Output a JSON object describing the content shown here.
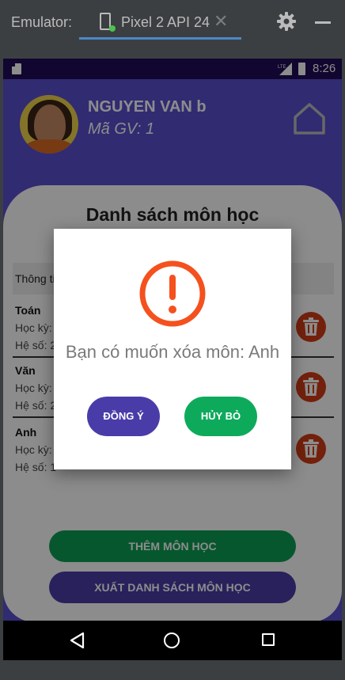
{
  "emulator": {
    "label": "Emulator:",
    "tab_label": "Pixel 2 API 24",
    "close_glyph": "✕",
    "icons": [
      "phone-device-icon",
      "close-icon",
      "gear-icon",
      "minimize-icon"
    ]
  },
  "status_bar": {
    "time": "8:26",
    "icons": [
      "sd-card-icon",
      "lte-signal-icon",
      "battery-icon"
    ]
  },
  "profile": {
    "name": "NGUYEN VAN b",
    "id_text": "Mã GV: 1",
    "icons": [
      "avatar",
      "home-icon"
    ]
  },
  "list": {
    "title": "Danh sách môn học",
    "header": "Thông ti",
    "subjects": [
      {
        "name": "Toán",
        "semester": "Học kỳ:",
        "coefficient": "Hệ số: 2"
      },
      {
        "name": "Văn",
        "semester": "Học kỳ:",
        "coefficient": "Hệ số: 2"
      },
      {
        "name": "Anh",
        "semester": "Học kỳ:",
        "coefficient": "Hệ số: 1"
      }
    ],
    "delete_icon": "trash-icon"
  },
  "actions": {
    "add_label": "THÊM MÔN HỌC",
    "export_label": "XUẤT DANH SÁCH MÔN HỌC"
  },
  "dialog": {
    "icon": "alert-circle-icon",
    "message": "Bạn có muốn xóa môn: Anh",
    "confirm_label": "ĐỒNG Ý",
    "cancel_label": "HỦY BỎ"
  },
  "nav": {
    "icons": [
      "back-icon",
      "home-circle-icon",
      "recents-icon"
    ]
  },
  "colors": {
    "primary": "#4a3ca8",
    "accent_green": "#0eaa5c",
    "danger": "#d23c17",
    "alert": "#f4511e"
  }
}
